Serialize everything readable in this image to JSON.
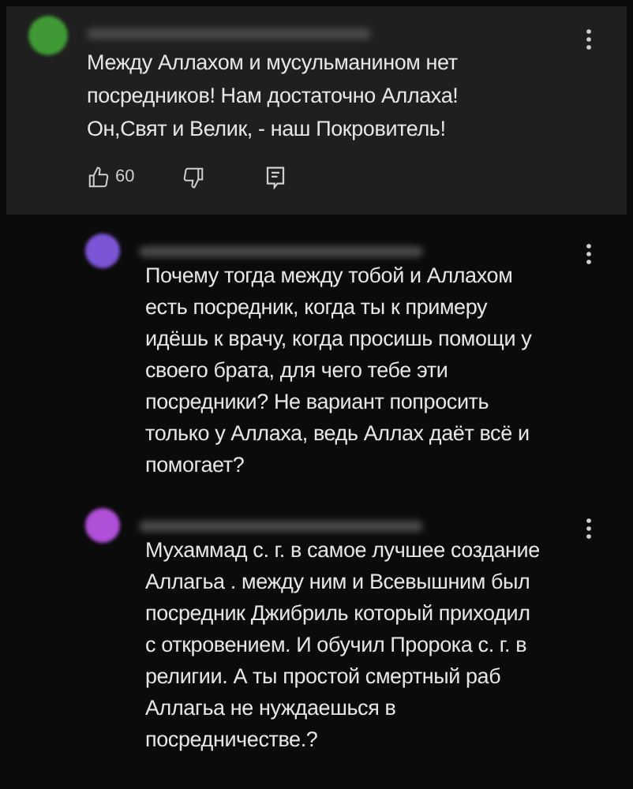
{
  "comment": {
    "color": "#3f9a35",
    "text": "Между Аллахом и мусульманином нет\nпосредников! Нам достаточно Аллаха!\nОн,Свят и Велик, - наш Покровитель!",
    "likes": "60"
  },
  "replies": [
    {
      "color": "#7b55d6",
      "text": "Почему тогда между тобой и Аллахом\nесть посредник, когда ты к примеру\nидёшь к врачу, когда просишь помощи у\nсвоего брата, для чего тебе эти\nпосредники? Не вариант попросить\nтолько у Аллаха, ведь Аллах даёт всё и\nпомогает?"
    },
    {
      "color": "#b04fd8",
      "text": "Мухаммад с. г. в самое лучшее создание\nАллагьа . между ним и Всевышним был\nпосредник Джибриль который приходил\nс откровением. И обучил Пророка с. г. в\nрелигии. А ты простой смертный раб\nАллагьа не нуждаешься в\nпосредничестве.?"
    }
  ]
}
